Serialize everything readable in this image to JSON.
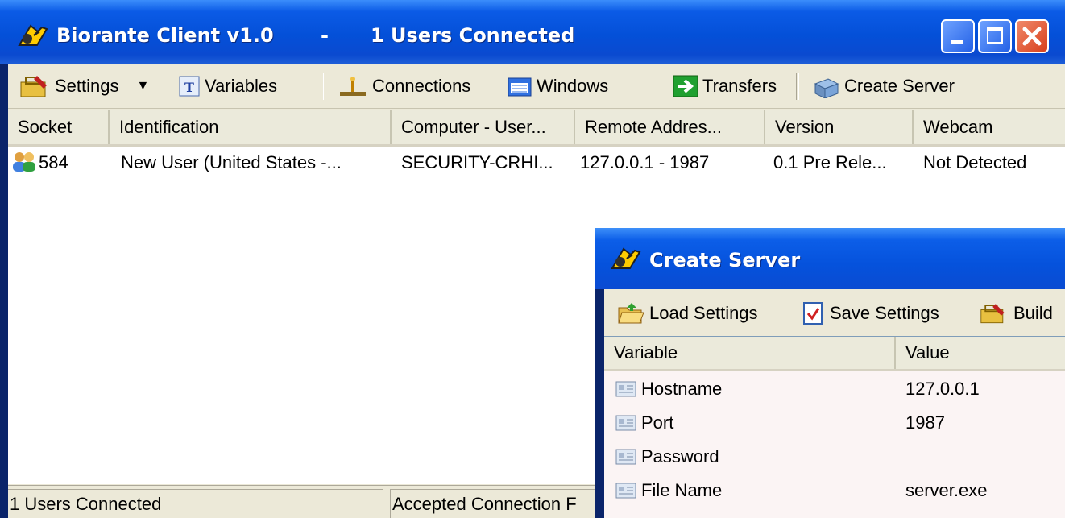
{
  "main_window": {
    "title": "Biorante Client v1.0",
    "separator": "-",
    "status_title": "1 Users Connected"
  },
  "toolbar": {
    "settings_label": "Settings",
    "variables_label": "Variables",
    "connections_label": "Connections",
    "windows_label": "Windows",
    "transfers_label": "Transfers",
    "create_server_label": "Create Server"
  },
  "list": {
    "columns": [
      "Socket",
      "Identification",
      "Computer - User...",
      "Remote Addres...",
      "Version",
      "Webcam"
    ],
    "rows": [
      {
        "socket": "584",
        "identification": "New User (United States -...",
        "computer_user": "SECURITY-CRHI...",
        "remote_address": "127.0.0.1 - 1987",
        "version": "0.1 Pre Rele...",
        "webcam": "Not Detected"
      }
    ]
  },
  "statusbar": {
    "left": "1 Users Connected",
    "right": "Accepted Connection F"
  },
  "create_server": {
    "title": "Create Server",
    "toolbar": {
      "load_label": "Load Settings",
      "save_label": "Save Settings",
      "build_label": "Build"
    },
    "columns": [
      "Variable",
      "Value"
    ],
    "rows": [
      {
        "variable": "Hostname",
        "value": "127.0.0.1"
      },
      {
        "variable": "Port",
        "value": "1987"
      },
      {
        "variable": "Password",
        "value": ""
      },
      {
        "variable": "File Name",
        "value": "server.exe"
      }
    ]
  },
  "colors": {
    "titlebar_blue": "#0450d8",
    "face": "#ece9d8",
    "close_red": "#d8401c"
  }
}
